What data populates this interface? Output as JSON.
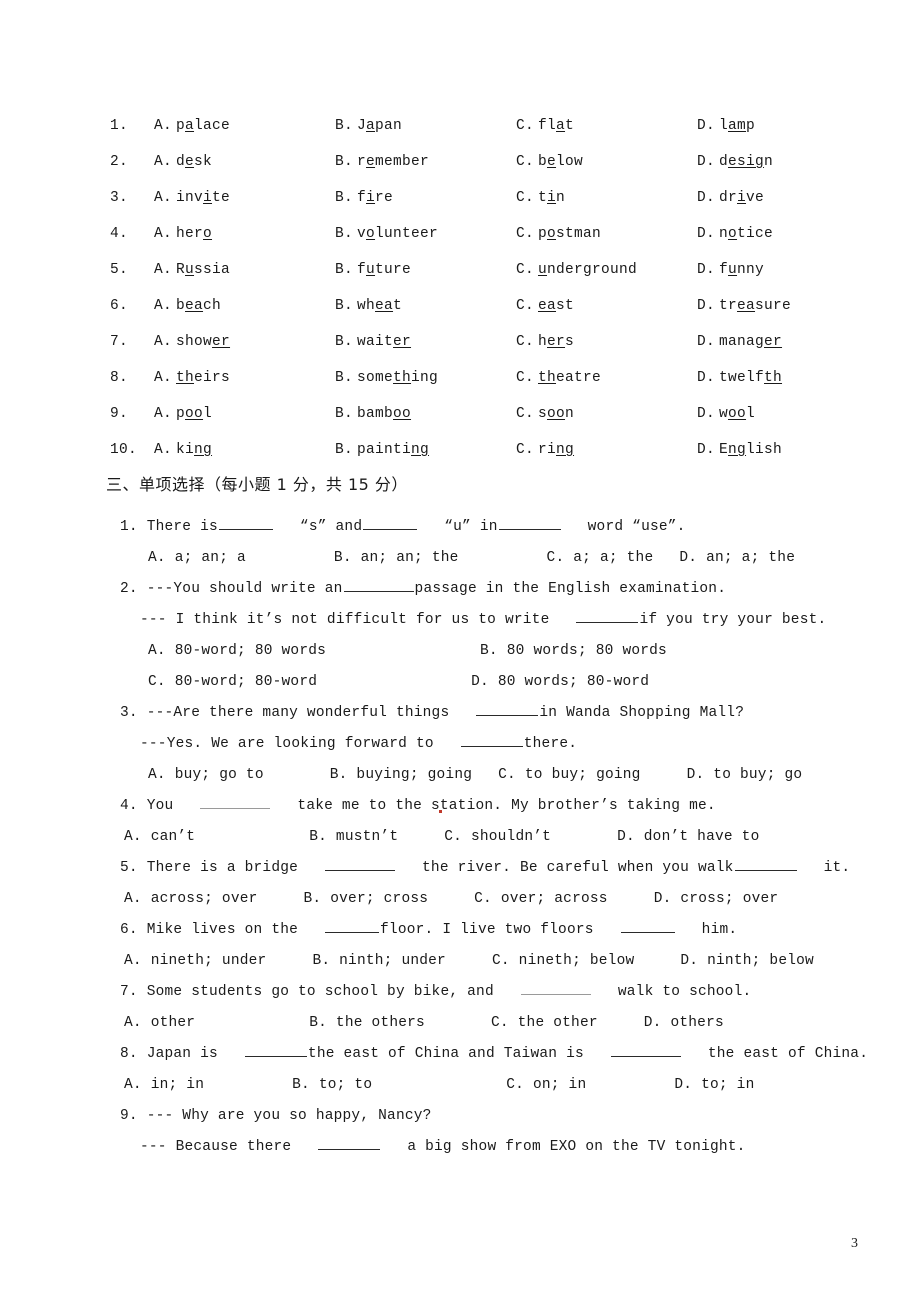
{
  "page": {
    "number": "3"
  },
  "word_section": {
    "rows": [
      {
        "num": "1.",
        "options": [
          {
            "letter": "A.",
            "pre": "p",
            "mid": "a",
            "post": "lace"
          },
          {
            "letter": "B.",
            "pre": "J",
            "mid": "a",
            "post": "pan"
          },
          {
            "letter": "C.",
            "pre": "fl",
            "mid": "a",
            "post": "t"
          },
          {
            "letter": "D.",
            "pre": "l",
            "mid": "am",
            "post": "p"
          }
        ]
      },
      {
        "num": "2.",
        "options": [
          {
            "letter": "A.",
            "pre": "d",
            "mid": "e",
            "post": "sk"
          },
          {
            "letter": "B.",
            "pre": "r",
            "mid": "e",
            "post": "member"
          },
          {
            "letter": "C.",
            "pre": "b",
            "mid": "e",
            "post": "low"
          },
          {
            "letter": "D.",
            "pre": "d",
            "mid": "esig",
            "post": "n"
          }
        ]
      },
      {
        "num": "3.",
        "options": [
          {
            "letter": "A.",
            "pre": "inv",
            "mid": "i",
            "post": "te"
          },
          {
            "letter": "B.",
            "pre": "f",
            "mid": "i",
            "post": "re"
          },
          {
            "letter": "C.",
            "pre": "t",
            "mid": "i",
            "post": "n"
          },
          {
            "letter": "D.",
            "pre": "dr",
            "mid": "i",
            "post": "ve"
          }
        ]
      },
      {
        "num": "4.",
        "options": [
          {
            "letter": "A.",
            "pre": "her",
            "mid": "o",
            "post": ""
          },
          {
            "letter": "B.",
            "pre": "v",
            "mid": "o",
            "post": "lunteer"
          },
          {
            "letter": "C.",
            "pre": "p",
            "mid": "o",
            "post": "stman"
          },
          {
            "letter": "D.",
            "pre": "n",
            "mid": "o",
            "post": "tice"
          }
        ]
      },
      {
        "num": "5.",
        "options": [
          {
            "letter": "A.",
            "pre": "R",
            "mid": "u",
            "post": "ssia"
          },
          {
            "letter": "B.",
            "pre": "f",
            "mid": "u",
            "post": "ture"
          },
          {
            "letter": "C.",
            "pre": "",
            "mid": "u",
            "post": "nderground"
          },
          {
            "letter": "D.",
            "pre": "f",
            "mid": "u",
            "post": "nny"
          }
        ]
      },
      {
        "num": "6.",
        "options": [
          {
            "letter": "A.",
            "pre": "b",
            "mid": "ea",
            "post": "ch"
          },
          {
            "letter": "B.",
            "pre": "wh",
            "mid": "ea",
            "post": "t"
          },
          {
            "letter": "C.",
            "pre": "",
            "mid": "ea",
            "post": "st"
          },
          {
            "letter": "D.",
            "pre": "tr",
            "mid": "ea",
            "post": "sure"
          }
        ]
      },
      {
        "num": "7.",
        "options": [
          {
            "letter": "A.",
            "pre": "show",
            "mid": "er",
            "post": ""
          },
          {
            "letter": "B.",
            "pre": "wait",
            "mid": "er",
            "post": ""
          },
          {
            "letter": "C.",
            "pre": "h",
            "mid": "er",
            "post": "s"
          },
          {
            "letter": "D.",
            "pre": "manag",
            "mid": "er",
            "post": ""
          }
        ]
      },
      {
        "num": "8.",
        "options": [
          {
            "letter": "A.",
            "pre": "",
            "mid": "th",
            "post": "eirs"
          },
          {
            "letter": "B.",
            "pre": "some",
            "mid": "th",
            "post": "ing"
          },
          {
            "letter": "C.",
            "pre": "",
            "mid": "th",
            "post": "eatre"
          },
          {
            "letter": "D.",
            "pre": "twelf",
            "mid": "th",
            "post": ""
          }
        ]
      },
      {
        "num": "9.",
        "options": [
          {
            "letter": "A.",
            "pre": "p",
            "mid": "oo",
            "post": "l"
          },
          {
            "letter": "B.",
            "pre": "bamb",
            "mid": "oo",
            "post": ""
          },
          {
            "letter": "C.",
            "pre": "s",
            "mid": "oo",
            "post": "n"
          },
          {
            "letter": "D.",
            "pre": "w",
            "mid": "oo",
            "post": "l"
          }
        ]
      },
      {
        "num": "10.",
        "options": [
          {
            "letter": "A.",
            "pre": "ki",
            "mid": "ng",
            "post": ""
          },
          {
            "letter": "B.",
            "pre": "painti",
            "mid": "ng",
            "post": ""
          },
          {
            "letter": "C.",
            "pre": "ri",
            "mid": "ng",
            "post": ""
          },
          {
            "letter": "D.",
            "pre": "E",
            "mid": "ng",
            "post": "lish"
          }
        ]
      }
    ]
  },
  "mc_section": {
    "heading": "三、单项选择（每小题 1 分，共 15 分）",
    "q1": {
      "stem_a": "1. There is",
      "stem_b": "“s” and",
      "stem_c": "“u” in",
      "stem_d": "word “use”.",
      "opt_a": "A. a; an; a",
      "opt_b": "B. an; an; the",
      "opt_c": "C. a; a; the",
      "opt_d": "D. an; a; the"
    },
    "q2": {
      "stem_a": "2. ---You should write an",
      "stem_b": "passage in the English examination.",
      "cont_a": "--- I think it’s not difficult for us to write",
      "cont_b": "if you try your best.",
      "opt_a": "A. 80-word; 80 words",
      "opt_b": "B. 80 words; 80 words",
      "opt_c": "C. 80-word; 80-word",
      "opt_d": "D. 80 words; 80-word"
    },
    "q3": {
      "stem_a": "3. ---Are there many wonderful things",
      "stem_b": "in Wanda Shopping Mall?",
      "cont_a": "---Yes. We are looking forward to",
      "cont_b": "there.",
      "opt_a": "A. buy; go to",
      "opt_b": "B. buying; going",
      "opt_c": "C. to buy; going",
      "opt_d": "D. to buy; go"
    },
    "q4": {
      "stem_a": "4. You",
      "stem_b": "take me to the s",
      "stem_c": "tation. My brother’s taking me.",
      "opt_a": "A. can’t",
      "opt_b": "B. mustn’t",
      "opt_c": "C. shouldn’t",
      "opt_d": "D. don’t have to"
    },
    "q5": {
      "stem_a": "5. There is a bridge",
      "stem_b": "the river. Be careful when you walk",
      "stem_c": "it.",
      "opt_a": "A. across; over",
      "opt_b": "B. over; cross",
      "opt_c": "C. over; across",
      "opt_d": "D. cross; over"
    },
    "q6": {
      "stem_a": "6. Mike lives on the",
      "stem_b": "floor. I live two floors",
      "stem_c": "him.",
      "opt_a": "A. nineth; under",
      "opt_b": "B. ninth; under",
      "opt_c": "C. nineth; below",
      "opt_d": "D. ninth; below"
    },
    "q7": {
      "stem_a": "7. Some students go to school by bike, and",
      "stem_b": "walk to school.",
      "opt_a": "A. other",
      "opt_b": "B. the others",
      "opt_c": "C. the other",
      "opt_d": "D. others"
    },
    "q8": {
      "stem_a": "8. Japan is",
      "stem_b": "the east of China and Taiwan is",
      "stem_c": "the east of China.",
      "opt_a": "A. in; in",
      "opt_b": "B. to; to",
      "opt_c": "C. on; in",
      "opt_d": "D. to; in"
    },
    "q9": {
      "stem_a": "9. --- Why are you so happy, Nancy?",
      "cont_a": "--- Because there",
      "cont_b": "a big show from EXO on the TV tonight."
    }
  }
}
